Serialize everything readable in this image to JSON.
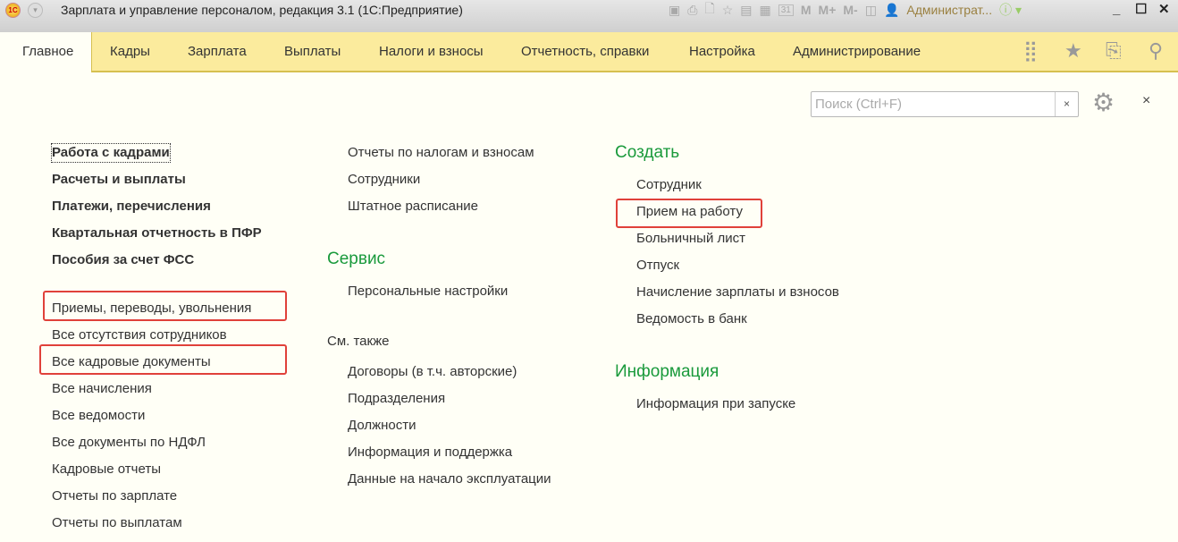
{
  "window": {
    "title": "Зарплата и управление персоналом, редакция 3.1  (1С:Предприятие)",
    "logo": "1С",
    "user": "Администрат...",
    "memory": [
      "M",
      "M+",
      "M-"
    ],
    "calendar_day": "31"
  },
  "tabs": [
    "Главное",
    "Кадры",
    "Зарплата",
    "Выплаты",
    "Налоги и взносы",
    "Отчетность, справки",
    "Настройка",
    "Администрирование"
  ],
  "search": {
    "placeholder": "Поиск (Ctrl+F)",
    "value": "",
    "clear": "×"
  },
  "close_label": "×",
  "col1": {
    "bold": [
      "Работа с кадрами",
      "Расчеты и выплаты",
      "Платежи, перечисления",
      "Квартальная отчетность в ПФР",
      "Пособия за счет ФСС"
    ],
    "items": [
      "Приемы, переводы, увольнения",
      "Все отсутствия сотрудников",
      "Все кадровые документы",
      "Все начисления",
      "Все ведомости",
      "Все документы по НДФЛ",
      "Кадровые отчеты",
      "Отчеты по зарплате",
      "Отчеты по выплатам"
    ]
  },
  "col2": {
    "items": [
      "Отчеты по налогам и взносам",
      "Сотрудники",
      "Штатное расписание"
    ],
    "service": {
      "title": "Сервис",
      "items": [
        "Персональные настройки"
      ]
    },
    "see_also": {
      "title": "См. также",
      "items": [
        "Договоры (в т.ч. авторские)",
        "Подразделения",
        "Должности",
        "Информация и поддержка",
        "Данные на начало эксплуатации"
      ]
    }
  },
  "col3": {
    "create": {
      "title": "Создать",
      "items": [
        "Сотрудник",
        "Прием на работу",
        "Больничный лист",
        "Отпуск",
        "Начисление зарплаты и взносов",
        "Ведомость в банк"
      ]
    },
    "info": {
      "title": "Информация",
      "items": [
        "Информация при запуске"
      ]
    }
  },
  "colors": {
    "accent_green": "#1a9a3c",
    "menubar": "#fbeb9d",
    "highlight": "#e0413a"
  }
}
